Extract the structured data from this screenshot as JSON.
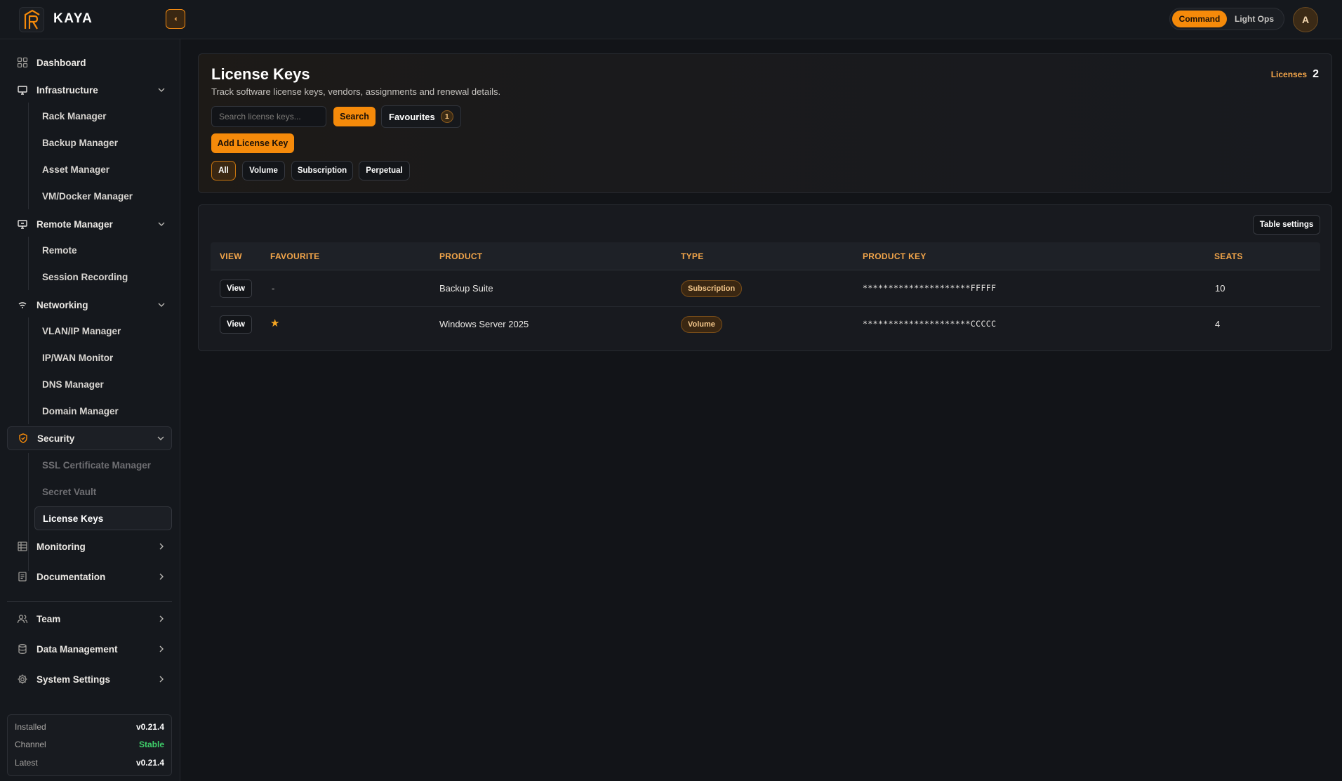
{
  "app": {
    "name": "KAYA"
  },
  "topbar": {
    "modes": [
      "Command",
      "Light Ops"
    ],
    "active_mode": "Command",
    "avatar_initial": "A"
  },
  "sidebar": {
    "dashboard": "Dashboard",
    "infrastructure": {
      "label": "Infrastructure",
      "items": [
        "Rack Manager",
        "Backup Manager",
        "Asset Manager",
        "VM/Docker Manager"
      ]
    },
    "remote": {
      "label": "Remote Manager",
      "items": [
        "Remote",
        "Session Recording"
      ]
    },
    "networking": {
      "label": "Networking",
      "items": [
        "VLAN/IP Manager",
        "IP/WAN Monitor",
        "DNS Manager",
        "Domain Manager"
      ]
    },
    "security": {
      "label": "Security",
      "items": [
        "SSL Certificate Manager",
        "Secret Vault",
        "License Keys"
      ]
    },
    "monitoring": "Monitoring",
    "documentation": "Documentation",
    "team": "Team",
    "data_management": "Data Management",
    "system_settings": "System Settings",
    "version": {
      "installed_label": "Installed",
      "installed": "v0.21.4",
      "channel_label": "Channel",
      "channel": "Stable",
      "latest_label": "Latest",
      "latest": "v0.21.4"
    }
  },
  "header": {
    "title": "License Keys",
    "subtitle": "Track software license keys, vendors, assignments and renewal details.",
    "licenses_label": "Licenses",
    "licenses_count": "2",
    "search_placeholder": "Search license keys...",
    "search_button": "Search",
    "favourites_label": "Favourites",
    "favourites_count": "1",
    "add_button": "Add License Key",
    "filters": [
      "All",
      "Volume",
      "Subscription",
      "Perpetual"
    ],
    "active_filter": "All"
  },
  "table": {
    "settings_button": "Table settings",
    "columns": [
      "VIEW",
      "FAVOURITE",
      "PRODUCT",
      "TYPE",
      "PRODUCT KEY",
      "SEATS"
    ],
    "rows": [
      {
        "view": "View",
        "favourite": "-",
        "product": "Backup Suite",
        "type": "Subscription",
        "key": "*********************FFFFF",
        "seats": "10"
      },
      {
        "view": "View",
        "favourite": "★",
        "product": "Windows Server 2025",
        "type": "Volume",
        "key": "*********************CCCCC",
        "seats": "4"
      }
    ]
  },
  "colors": {
    "accent": "#f58a0a",
    "accent_text": "#f4a64a",
    "success": "#3fcf6a",
    "background": "#121418"
  }
}
